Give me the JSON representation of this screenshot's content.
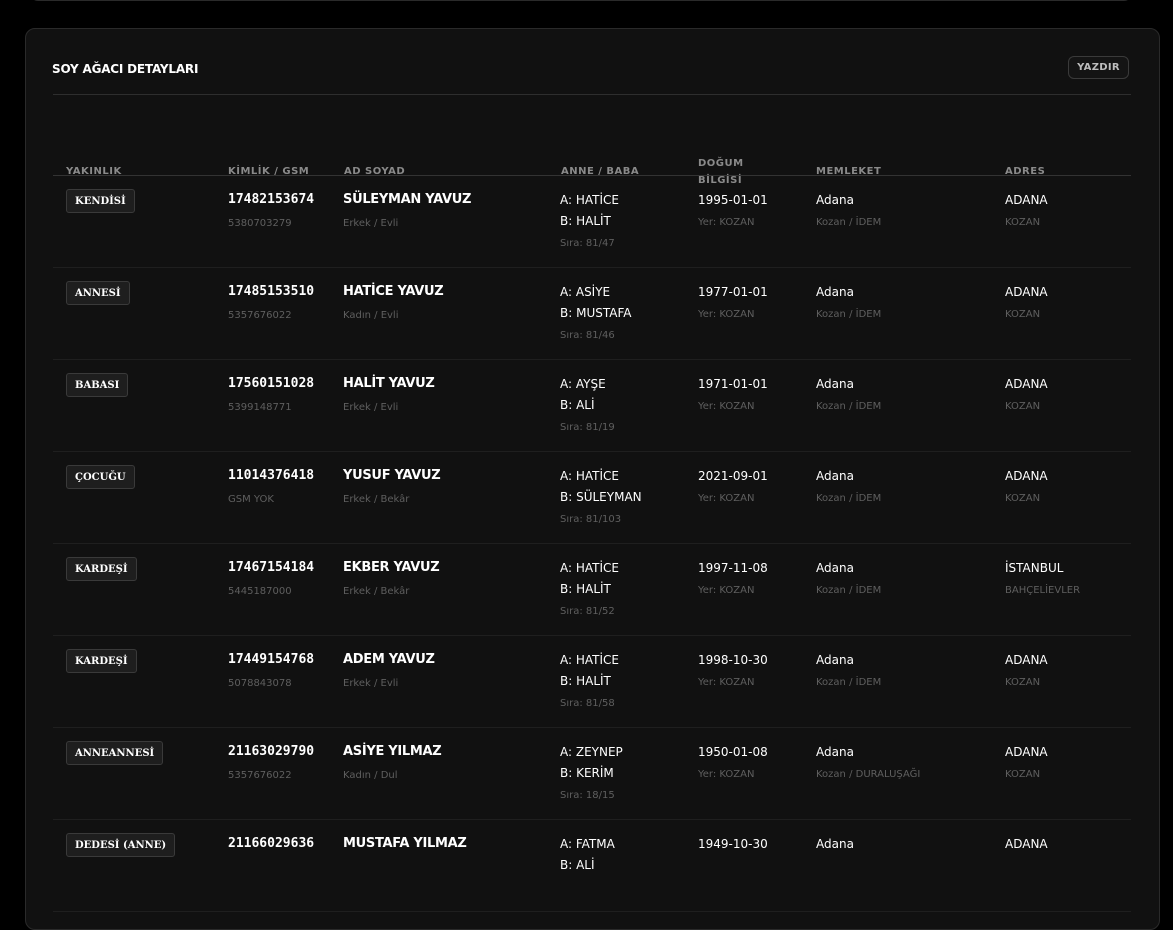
{
  "card": {
    "title": "SOY AĞACI DETAYLARI",
    "print_label": "YAZDIR"
  },
  "columns": [
    "YAKINLIK",
    "KİMLİK / GSM",
    "AD SOYAD",
    "ANNE / BABA",
    "DOĞUM BİLGİSİ",
    "MEMLEKET",
    "ADRES"
  ],
  "rows": [
    {
      "relation": "KENDİSİ",
      "id": "17482153674",
      "gsm": "5380703279",
      "name": "SÜLEYMAN YAVUZ",
      "gender": "Erkek / Evli",
      "mother": "A: HATİCE",
      "father": "B: HALİT",
      "order": "Sıra: 81/47",
      "birth_date": "1995-01-01",
      "birth_place": "Yer: KOZAN",
      "city": "Adana",
      "district": "Kozan / İDEM",
      "address_city": "ADANA",
      "address_district": "KOZAN"
    },
    {
      "relation": "ANNESİ",
      "id": "17485153510",
      "gsm": "5357676022",
      "name": "HATİCE YAVUZ",
      "gender": "Kadın / Evli",
      "mother": "A: ASİYE",
      "father": "B: MUSTAFA",
      "order": "Sıra: 81/46",
      "birth_date": "1977-01-01",
      "birth_place": "Yer: KOZAN",
      "city": "Adana",
      "district": "Kozan / İDEM",
      "address_city": "ADANA",
      "address_district": "KOZAN"
    },
    {
      "relation": "BABASI",
      "id": "17560151028",
      "gsm": "5399148771",
      "name": "HALİT YAVUZ",
      "gender": "Erkek / Evli",
      "mother": "A: AYŞE",
      "father": "B: ALİ",
      "order": "Sıra: 81/19",
      "birth_date": "1971-01-01",
      "birth_place": "Yer: KOZAN",
      "city": "Adana",
      "district": "Kozan / İDEM",
      "address_city": "ADANA",
      "address_district": "KOZAN"
    },
    {
      "relation": "ÇOCUĞU",
      "id": "11014376418",
      "gsm": "GSM YOK",
      "name": "YUSUF YAVUZ",
      "gender": "Erkek / Bekâr",
      "mother": "A: HATİCE",
      "father": "B: SÜLEYMAN",
      "order": "Sıra: 81/103",
      "birth_date": "2021-09-01",
      "birth_place": "Yer: KOZAN",
      "city": "Adana",
      "district": "Kozan / İDEM",
      "address_city": "ADANA",
      "address_district": "KOZAN"
    },
    {
      "relation": "KARDEŞİ",
      "id": "17467154184",
      "gsm": "5445187000",
      "name": "EKBER YAVUZ",
      "gender": "Erkek / Bekâr",
      "mother": "A: HATİCE",
      "father": "B: HALİT",
      "order": "Sıra: 81/52",
      "birth_date": "1997-11-08",
      "birth_place": "Yer: KOZAN",
      "city": "Adana",
      "district": "Kozan / İDEM",
      "address_city": "İSTANBUL",
      "address_district": "BAHÇELİEVLER"
    },
    {
      "relation": "KARDEŞİ",
      "id": "17449154768",
      "gsm": "5078843078",
      "name": "ADEM YAVUZ",
      "gender": "Erkek / Evli",
      "mother": "A: HATİCE",
      "father": "B: HALİT",
      "order": "Sıra: 81/58",
      "birth_date": "1998-10-30",
      "birth_place": "Yer: KOZAN",
      "city": "Adana",
      "district": "Kozan / İDEM",
      "address_city": "ADANA",
      "address_district": "KOZAN"
    },
    {
      "relation": "ANNEANNESİ",
      "id": "21163029790",
      "gsm": "5357676022",
      "name": "ASİYE YILMAZ",
      "gender": "Kadın / Dul",
      "mother": "A: ZEYNEP",
      "father": "B: KERİM",
      "order": "Sıra: 18/15",
      "birth_date": "1950-01-08",
      "birth_place": "Yer: KOZAN",
      "city": "Adana",
      "district": "Kozan / DURALUŞAĞI",
      "address_city": "ADANA",
      "address_district": "KOZAN"
    },
    {
      "relation": "DEDESİ (ANNE)",
      "id": "21166029636",
      "gsm": "",
      "name": "MUSTAFA YILMAZ",
      "gender": "",
      "mother": "A: FATMA",
      "father": "B: ALİ",
      "order": "",
      "birth_date": "1949-10-30",
      "birth_place": "",
      "city": "Adana",
      "district": "",
      "address_city": "ADANA",
      "address_district": ""
    }
  ]
}
